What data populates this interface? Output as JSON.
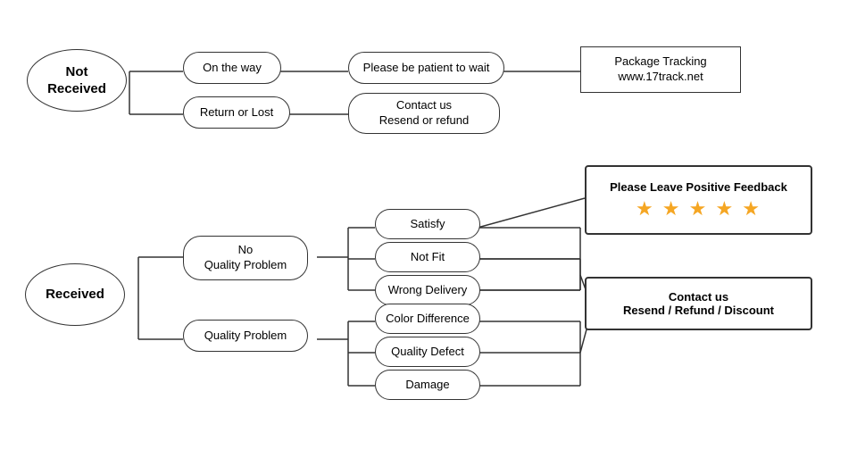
{
  "nodes": {
    "not_received": {
      "label": "Not\nReceived"
    },
    "received": {
      "label": "Received"
    },
    "on_the_way": {
      "label": "On the way"
    },
    "return_or_lost": {
      "label": "Return or Lost"
    },
    "patient_wait": {
      "label": "Please be patient to wait"
    },
    "contact_resend_refund": {
      "label": "Contact us\nResend or refund"
    },
    "package_tracking": {
      "label": "Package Tracking\nwww.17track.net"
    },
    "no_quality_problem": {
      "label": "No\nQuality Problem"
    },
    "quality_problem": {
      "label": "Quality Problem"
    },
    "satisfy": {
      "label": "Satisfy"
    },
    "not_fit": {
      "label": "Not Fit"
    },
    "wrong_delivery": {
      "label": "Wrong Delivery"
    },
    "color_difference": {
      "label": "Color Difference"
    },
    "quality_defect": {
      "label": "Quality Defect"
    },
    "damage": {
      "label": "Damage"
    },
    "feedback_title": {
      "label": "Please Leave Positive Feedback"
    },
    "stars": {
      "label": "★ ★ ★ ★ ★"
    },
    "contact_resend_refund_discount": {
      "label": "Contact us\nResend / Refund / Discount"
    }
  }
}
